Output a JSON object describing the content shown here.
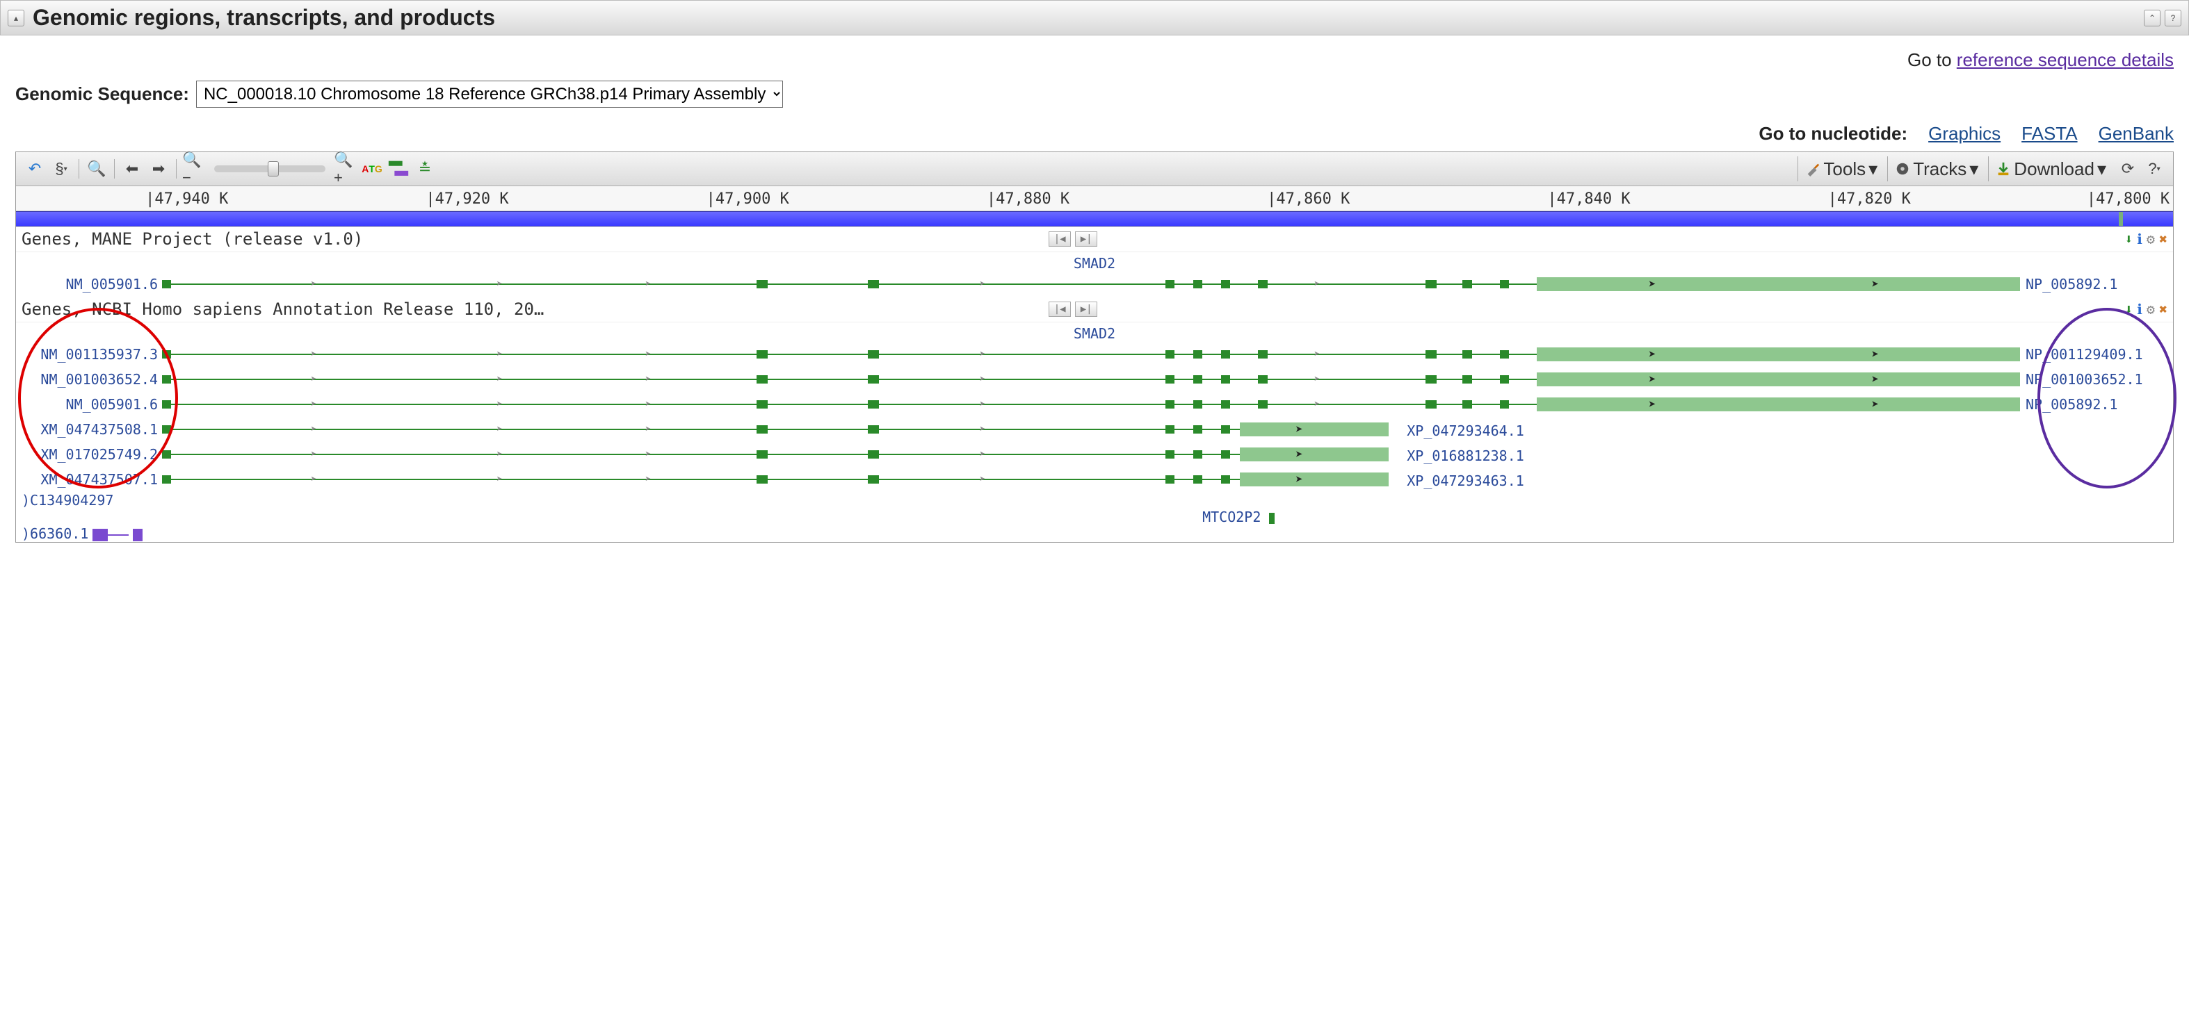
{
  "header": {
    "title": "Genomic regions, transcripts, and products"
  },
  "go_to_text": "Go to ",
  "ref_link": "reference sequence details",
  "seq_label": "Genomic Sequence:",
  "seq_value": "NC_000018.10 Chromosome 18 Reference GRCh38.p14 Primary Assembly",
  "nuc_label": "Go to nucleotide:",
  "nuc_links": {
    "graphics": "Graphics",
    "fasta": "FASTA",
    "genbank": "GenBank"
  },
  "menus": {
    "tools": "Tools",
    "tracks": "Tracks",
    "download": "Download"
  },
  "ruler": [
    "|47,940 K",
    "|47,920 K",
    "|47,900 K",
    "|47,880 K",
    "|47,860 K",
    "|47,840 K",
    "|47,820 K",
    "|47,800 K"
  ],
  "tracks": {
    "mane": {
      "title": "Genes, MANE Project (release v1.0)",
      "gene": "SMAD2",
      "rows": [
        {
          "left": "NM_005901.6",
          "right": "NP_005892.1"
        }
      ]
    },
    "ncbi": {
      "title": "Genes, NCBI Homo sapiens Annotation Release 110, 20…",
      "gene": "SMAD2",
      "rows": [
        {
          "left": "NM_001135937.3",
          "right": "NP_001129409.1"
        },
        {
          "left": "NM_001003652.4",
          "right": "NP_001003652.1"
        },
        {
          "left": "NM_005901.6",
          "right": "NP_005892.1"
        },
        {
          "left": "XM_047437508.1",
          "right": "XP_047293464.1",
          "short": true
        },
        {
          "left": "XM_017025749.2",
          "right": "XP_016881238.1",
          "short": true
        },
        {
          "left": "XM_047437507.1",
          "right": "XP_047293463.1",
          "short": true
        }
      ]
    }
  },
  "extra": {
    "loc": ")C134904297",
    "gene2": "MTCO2P2",
    "tx": ")66360.1"
  }
}
